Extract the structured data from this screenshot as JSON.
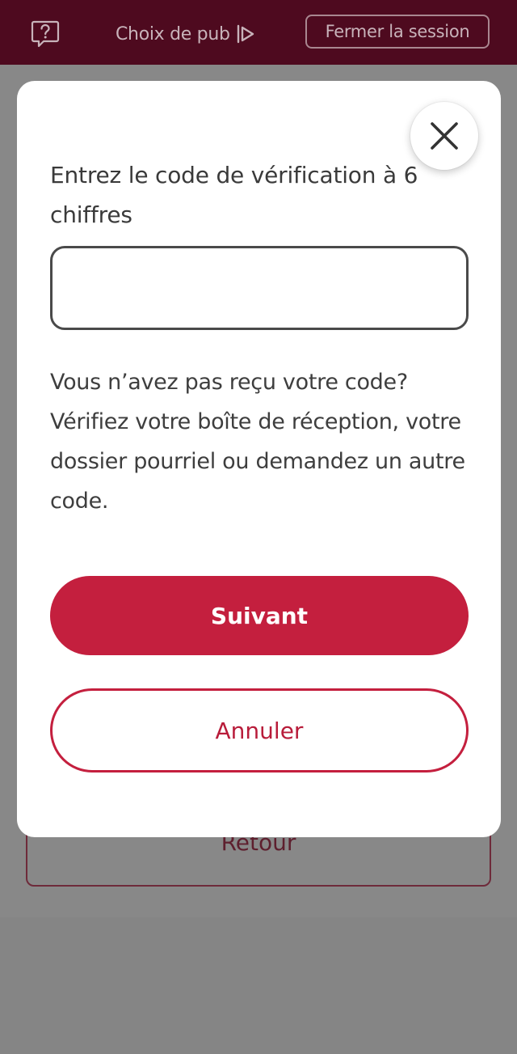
{
  "topbar": {
    "help_icon": "speech-bubble-question-icon",
    "adchoice_label": "Choix de pub",
    "adchoice_icon": "adchoices-icon",
    "logout_label": "Fermer la session"
  },
  "background": {
    "back_label": "Retour"
  },
  "modal": {
    "close_icon": "close-icon",
    "prompt": "Entrez le code de vérification à 6 chiffres",
    "code_value": "",
    "help_text": "Vous n’avez pas reçu votre code? Vérifiez votre boîte de réception, votre dossier pourriel ou demandez un autre code.",
    "next_label": "Suivant",
    "cancel_label": "Annuler"
  },
  "colors": {
    "topbar_bg": "#4e0a1f",
    "overlay": "#858585",
    "primary": "#c41f3e"
  }
}
